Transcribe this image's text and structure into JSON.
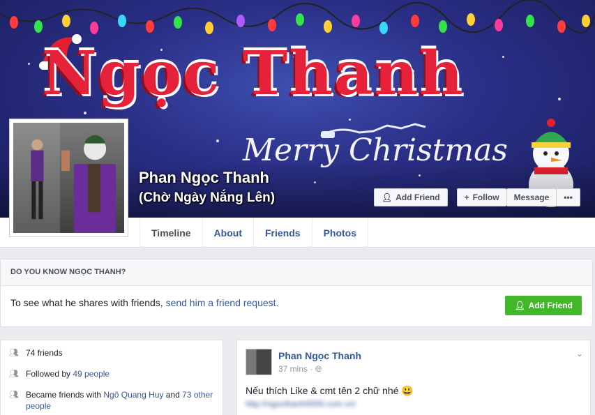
{
  "cover": {
    "title": "Ngọc Thanh",
    "subtitle": "Merry Christmas",
    "colors": {
      "sky": "#2a2f86",
      "title_red": "#e6223b"
    }
  },
  "profile": {
    "name": "Phan Ngọc Thanh",
    "alternate_name": "(Chờ Ngày Nắng Lên)"
  },
  "actions": {
    "add_friend": "Add Friend",
    "follow": "Follow",
    "message": "Message",
    "more": "•••"
  },
  "tabs": [
    {
      "label": "Timeline"
    },
    {
      "label": "About"
    },
    {
      "label": "Friends"
    },
    {
      "label": "Photos"
    }
  ],
  "know_box": {
    "heading": "DO YOU KNOW NGỌC THANH?",
    "text": "To see what he shares with friends, ",
    "link": "send him a friend request.",
    "button": "Add Friend",
    "button_color": "#42b72a"
  },
  "intro": {
    "friends": "74 friends",
    "followed_prefix": "Followed by ",
    "followed_link": "49 people",
    "became_prefix": "Became friends with ",
    "became_link1": "Ngô Quang Huy",
    "became_mid": " and ",
    "became_link2": "73 other people"
  },
  "post": {
    "author": "Phan Ngọc Thanh",
    "time": "37 mins · ",
    "text": "Nếu thích Like & cmt tên 2 chữ nhé 😃",
    "link": "http://ngocthanh0000.com.vn/"
  }
}
